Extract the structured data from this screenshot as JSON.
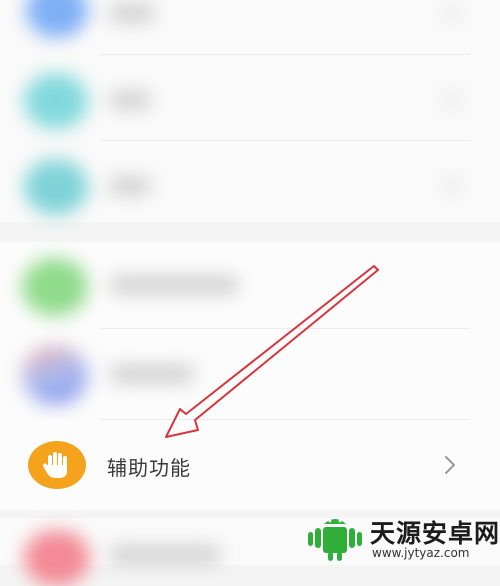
{
  "settings_list": {
    "accessibility_item": {
      "label": "辅助功能",
      "icon": "raised-hand-icon",
      "icon_color": "#f5a21c"
    }
  },
  "watermark": {
    "brand": "天源安卓网",
    "url": "www.jytyaz.com",
    "accent_color": "#2fae3a"
  },
  "annotation": {
    "arrow_color": "#d9343c"
  }
}
